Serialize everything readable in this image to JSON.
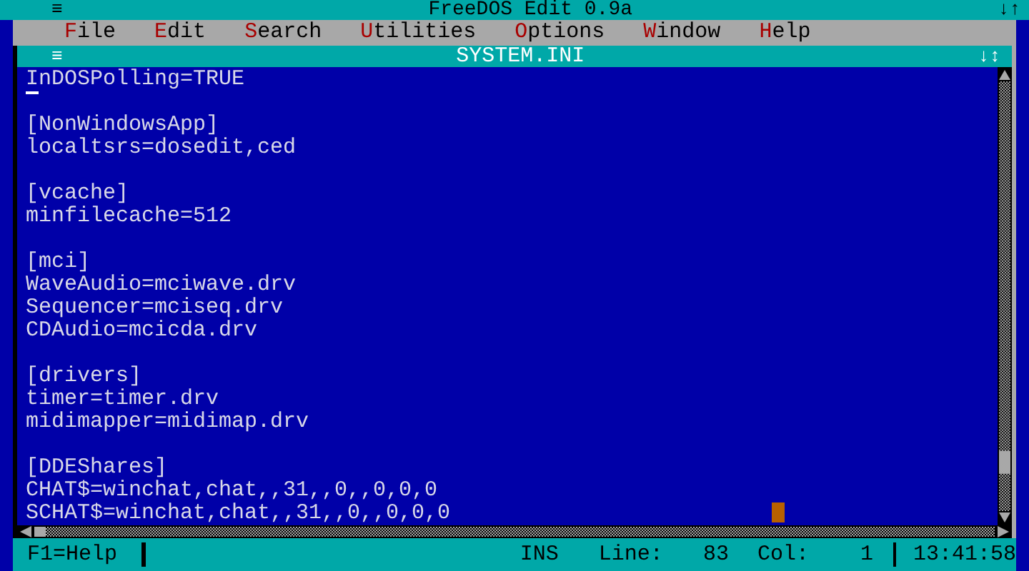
{
  "window": {
    "menu_glyph": "≡",
    "title": "FreeDOS Edit 0.9a",
    "size_glyph": "↓↑"
  },
  "menu": [
    {
      "label": "File"
    },
    {
      "label": "Edit"
    },
    {
      "label": "Search"
    },
    {
      "label": "Utilities"
    },
    {
      "label": "Options"
    },
    {
      "label": "Window"
    },
    {
      "label": "Help"
    }
  ],
  "document": {
    "menu_glyph": "≡",
    "title": "SYSTEM.INI",
    "size_glyph": "↓↕",
    "sections": [
      {
        "lines": [
          "InDOSPolling=TRUE"
        ]
      },
      {
        "lines": [
          "[NonWindowsApp]",
          "localtsrs=dosedit,ced"
        ]
      },
      {
        "lines": [
          "[vcache]",
          "minfilecache=512"
        ]
      },
      {
        "lines": [
          "[mci]",
          "WaveAudio=mciwave.drv",
          "Sequencer=mciseq.drv",
          "CDAudio=mcicda.drv"
        ]
      },
      {
        "lines": [
          "[drivers]",
          "timer=timer.drv",
          "midimapper=midimap.drv"
        ]
      },
      {
        "lines": [
          "[DDEShares]",
          "CHAT$=winchat,chat,,31,,0,,0,0,0",
          "SCHAT$=winchat,chat,,31,,0,,0,0,0"
        ]
      }
    ]
  },
  "status_bar": {
    "help": "F1=Help",
    "mode": "INS",
    "line_label": "Line:",
    "line": "83",
    "col_label": "Col:",
    "col": "1",
    "time": "13:41:58"
  }
}
